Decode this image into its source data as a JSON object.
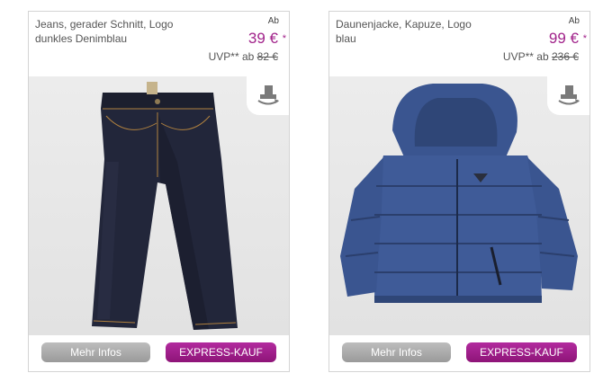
{
  "products": [
    {
      "title": "Jeans, gerader Schnitt, Logo dunkles Denimblau",
      "from_label": "Ab",
      "price": "39 €",
      "price_note": "*",
      "uvp_label": "UVP** ab",
      "uvp_old_price": "82 €",
      "more_info_label": "Mehr Infos",
      "express_label": "EXPRESS-KAUF",
      "image_icon": "jeans-image",
      "view_icon": "rotate-view-icon"
    },
    {
      "title": "Daunenjacke, Kapuze, Logo blau",
      "from_label": "Ab",
      "price": "99 €",
      "price_note": "*",
      "uvp_label": "UVP** ab",
      "uvp_old_price": "236 €",
      "more_info_label": "Mehr Infos",
      "express_label": "EXPRESS-KAUF",
      "image_icon": "jacket-image",
      "view_icon": "rotate-view-icon"
    }
  ],
  "colors": {
    "accent": "#a1228a",
    "button_gray": "#a8a8a8",
    "jeans": "#1f2233",
    "jacket": "#3e5a96"
  }
}
